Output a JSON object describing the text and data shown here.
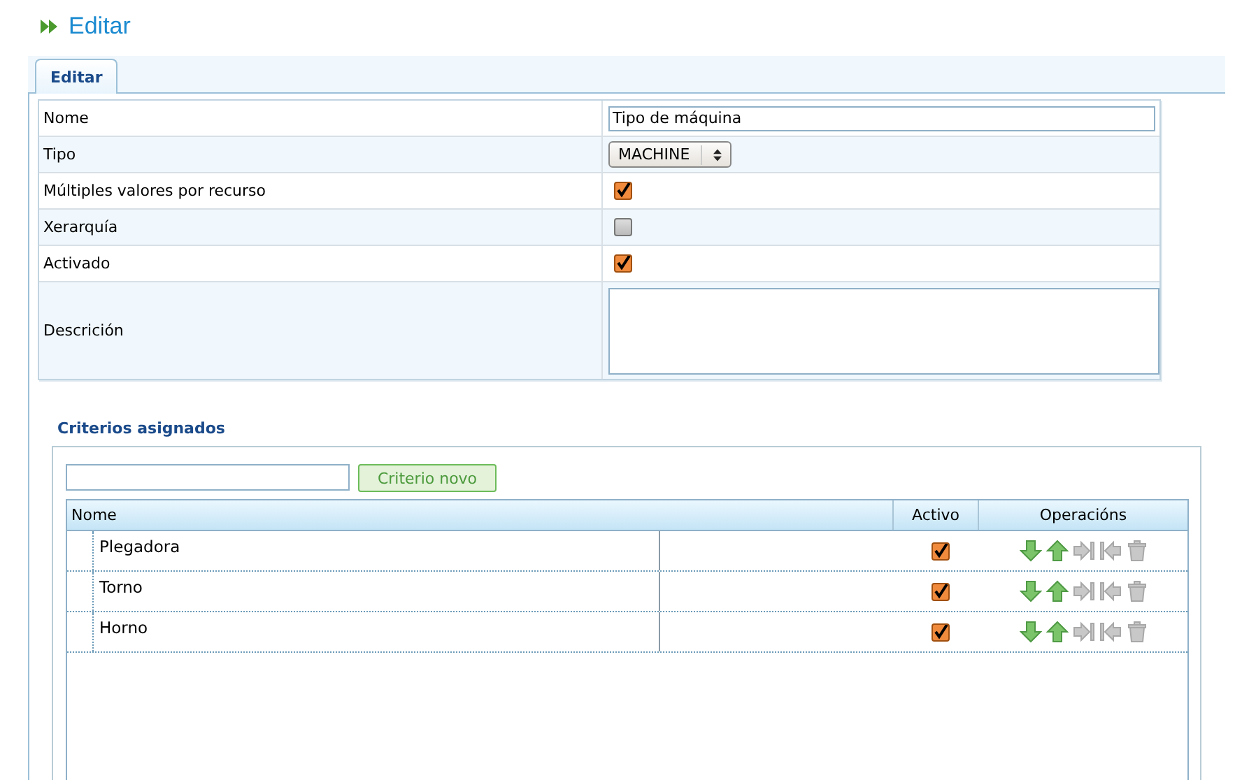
{
  "page_title": "Editar",
  "tabs": [
    {
      "label": "Editar",
      "selected": true
    }
  ],
  "form": {
    "rows": [
      {
        "label": "Nome",
        "kind": "text",
        "value": "Tipo de máquina"
      },
      {
        "label": "Tipo",
        "kind": "select",
        "value": "MACHINE"
      },
      {
        "label": "Múltiples valores por recurso",
        "kind": "checkbox",
        "checked": true
      },
      {
        "label": "Xerarquía",
        "kind": "checkbox",
        "checked": false
      },
      {
        "label": "Activado",
        "kind": "checkbox",
        "checked": true
      },
      {
        "label": "Descrición",
        "kind": "textarea"
      }
    ]
  },
  "criteria": {
    "title": "Criterios asignados",
    "new_button": "Criterio novo",
    "columns": [
      "Nome",
      "Activo",
      "Operacións"
    ],
    "rows": [
      {
        "name": "Plegadora",
        "active": true,
        "operations": [
          {
            "kind": "down",
            "disabled": false
          },
          {
            "kind": "up",
            "disabled": false
          },
          {
            "kind": "indent",
            "disabled": true
          },
          {
            "kind": "unindent",
            "disabled": true
          },
          {
            "kind": "delete",
            "disabled": true
          }
        ]
      },
      {
        "name": "Torno",
        "active": true,
        "operations": [
          {
            "kind": "down",
            "disabled": false
          },
          {
            "kind": "up",
            "disabled": false
          },
          {
            "kind": "indent",
            "disabled": true
          },
          {
            "kind": "unindent",
            "disabled": true
          },
          {
            "kind": "delete",
            "disabled": true
          }
        ]
      },
      {
        "name": "Horno",
        "active": true,
        "operations": [
          {
            "kind": "down",
            "disabled": false
          },
          {
            "kind": "up",
            "disabled": false
          },
          {
            "kind": "indent",
            "disabled": true
          },
          {
            "kind": "unindent",
            "disabled": true
          },
          {
            "kind": "delete",
            "disabled": true
          }
        ]
      }
    ]
  }
}
